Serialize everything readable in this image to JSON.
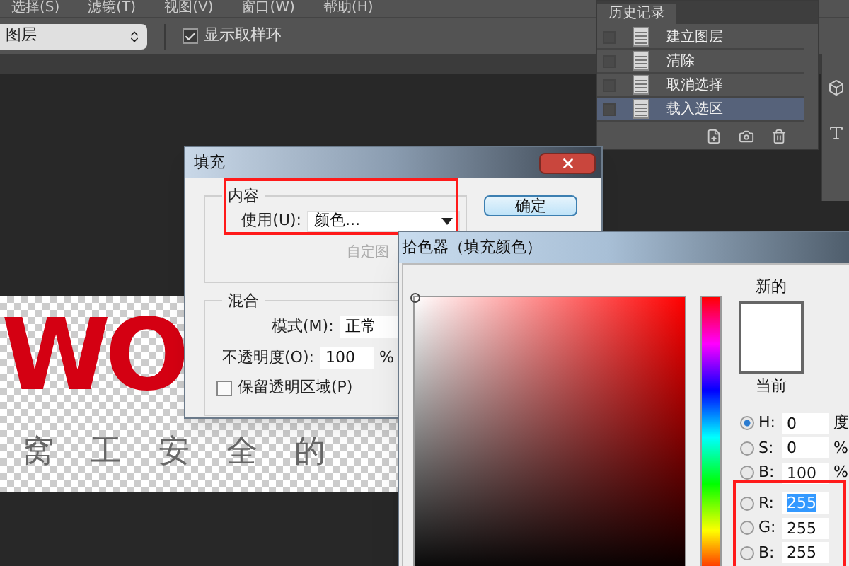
{
  "menu_bar": [
    "选择(S)",
    "滤镜(T)",
    "视图(V)",
    "窗口(W)",
    "帮助(H)"
  ],
  "options_bar": {
    "sample_select": "图层",
    "sample_ring": {
      "label": "显示取样环",
      "checked": true
    }
  },
  "history_panel": {
    "tab": "历史记录",
    "items": [
      {
        "label": "建立图层",
        "selected": false
      },
      {
        "label": "清除",
        "selected": false
      },
      {
        "label": "取消选择",
        "selected": false
      },
      {
        "label": "载入选区",
        "selected": true
      }
    ]
  },
  "canvas": {
    "logo_text": "WO",
    "selection_text": [
      "窝",
      "工",
      "安",
      "全",
      "的"
    ]
  },
  "fill_dialog": {
    "title": "填充",
    "contents": {
      "heading": "内容",
      "use_label": "使用(U):",
      "use_value": "颜色...",
      "custom_pattern_label": "自定图"
    },
    "ok_button": "确定",
    "blending": {
      "heading": "混合",
      "mode_label": "模式(M):",
      "mode_value": "正常",
      "opacity_label": "不透明度(O):",
      "opacity_value": "100",
      "opacity_unit": "%",
      "preserve": {
        "label": "保留透明区域(P)",
        "checked": false
      }
    }
  },
  "color_picker": {
    "title": "拾色器（填充颜色）",
    "new_label": "新的",
    "current_label": "当前",
    "fields": [
      {
        "label": "H:",
        "value": "0",
        "unit": "度",
        "selected": true,
        "highlighted": false
      },
      {
        "label": "S:",
        "value": "0",
        "unit": "%",
        "selected": false,
        "highlighted": false
      },
      {
        "label": "B:",
        "value": "100",
        "unit": "%",
        "selected": false,
        "highlighted": false
      },
      {
        "label": "R:",
        "value": "255",
        "selected": false,
        "highlighted": true
      },
      {
        "label": "G:",
        "value": "255",
        "selected": false,
        "highlighted": false
      },
      {
        "label": "B:",
        "value": "255",
        "selected": false,
        "highlighted": false
      }
    ]
  }
}
